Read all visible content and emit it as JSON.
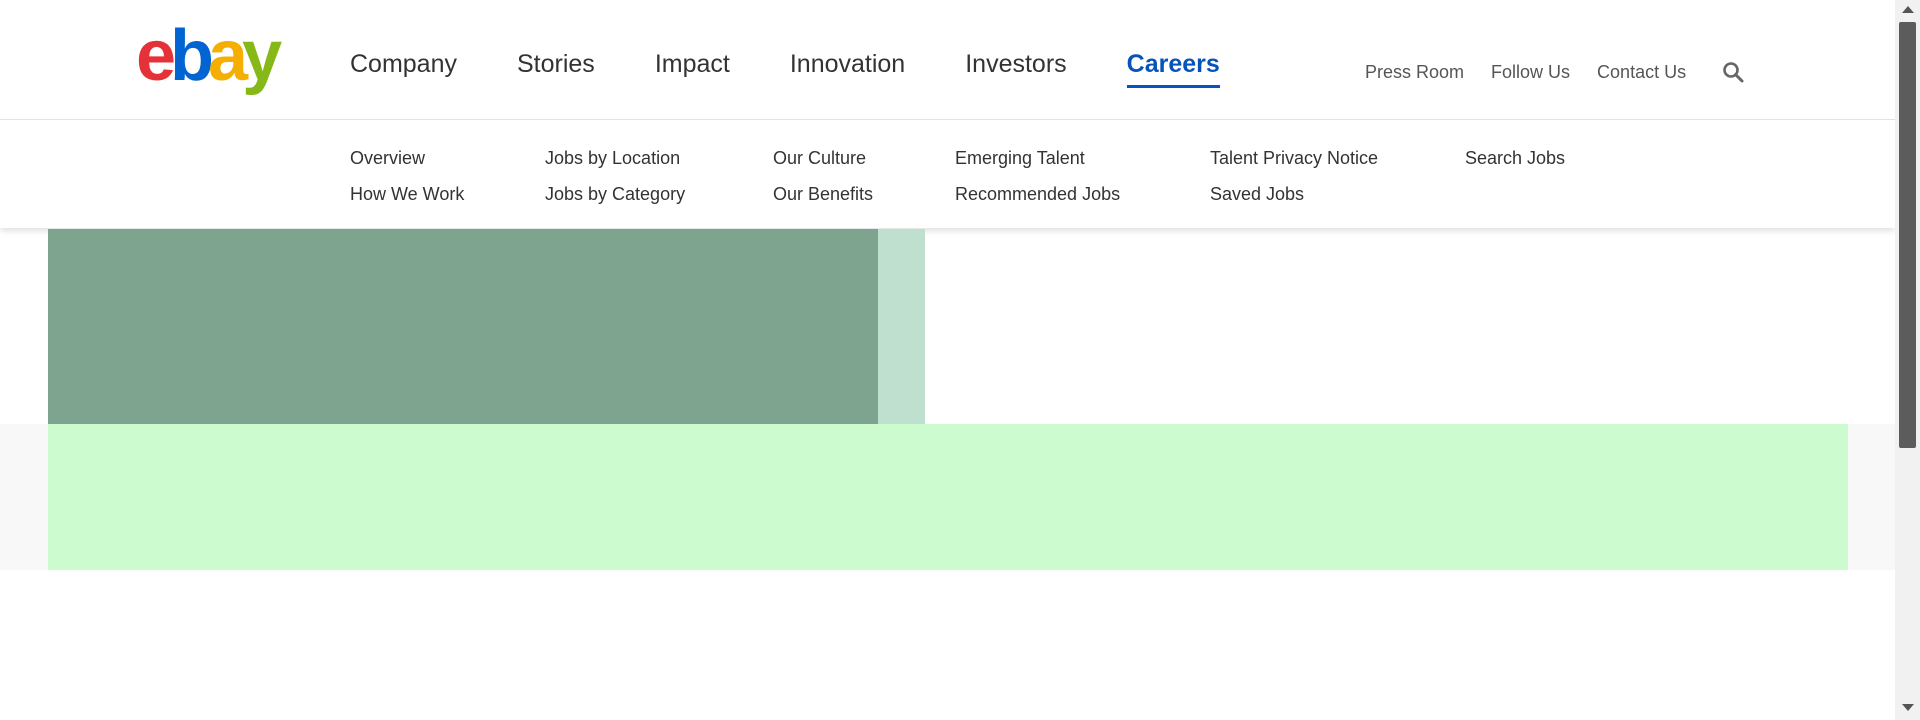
{
  "header": {
    "logo": {
      "letters": [
        "e",
        "b",
        "a",
        "y"
      ],
      "colors": [
        "#e53238",
        "#0064d2",
        "#f5af02",
        "#86b817"
      ]
    },
    "main_nav": [
      {
        "label": "Company"
      },
      {
        "label": "Stories"
      },
      {
        "label": "Impact"
      },
      {
        "label": "Innovation"
      },
      {
        "label": "Investors"
      },
      {
        "label": "Careers",
        "active": true
      }
    ],
    "util_nav": [
      {
        "label": "Press Room"
      },
      {
        "label": "Follow Us"
      },
      {
        "label": "Contact Us"
      }
    ],
    "search_icon": "search-icon"
  },
  "subnav": {
    "columns": [
      [
        "Overview",
        "How We Work"
      ],
      [
        "Jobs by Location",
        "Jobs by Category"
      ],
      [
        "Our Culture",
        "Our Benefits"
      ],
      [
        "Emerging Talent",
        "Recommended Jobs"
      ],
      [
        "Talent Privacy Notice",
        "Saved Jobs"
      ],
      [
        "Search Jobs"
      ]
    ]
  },
  "colors": {
    "accent": "#0654ba",
    "block_dark": "#7ea38f",
    "block_light": "#bfe0cf",
    "band_green": "#ccfbcf"
  }
}
